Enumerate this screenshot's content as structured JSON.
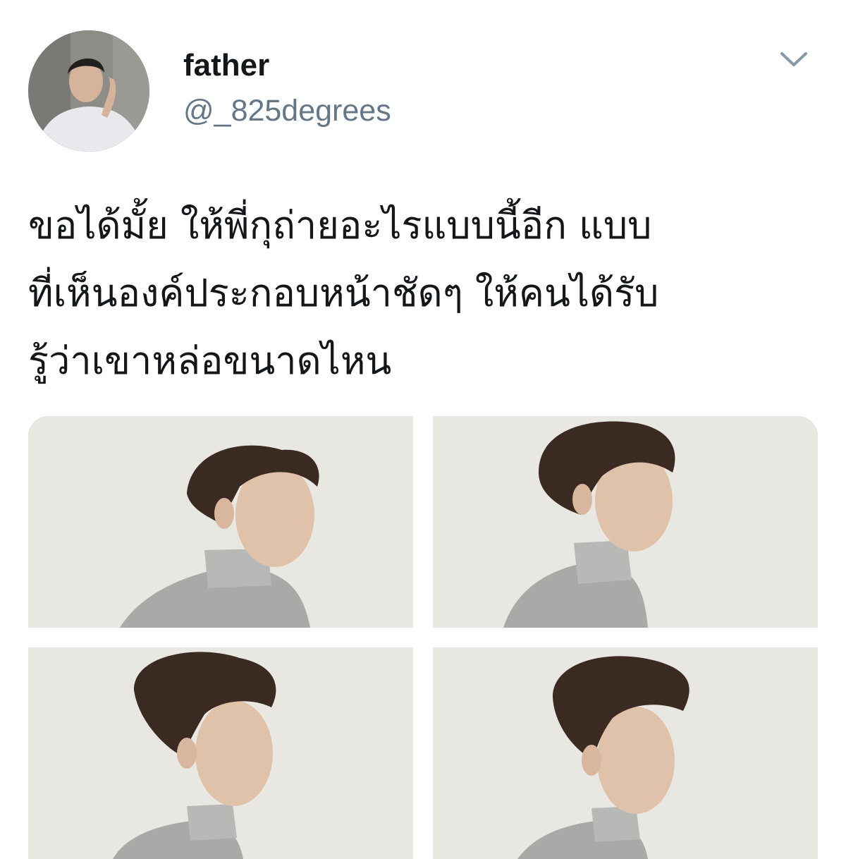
{
  "tweet": {
    "author": {
      "display_name": "father",
      "handle": "@_825degrees",
      "avatar_icon": "profile-photo"
    },
    "menu_icon": "chevron-down-icon",
    "text_lines": [
      "ขอได้มั้ย ให้พี่กุถ่ายอะไรแบบนี้อีก แบบ",
      "ที่เห็นองค์ประกอบหน้าชัดๆ ให้คนได้รับ",
      "รู้ว่าเขาหล่อขนาดไหน"
    ],
    "media": [
      {
        "icon": "portrait-photo"
      },
      {
        "icon": "portrait-photo"
      },
      {
        "icon": "portrait-photo"
      },
      {
        "icon": "portrait-photo"
      }
    ]
  },
  "colors": {
    "text_primary": "#14171a",
    "text_secondary": "#657786",
    "photo_background": "#e9e7e2"
  }
}
